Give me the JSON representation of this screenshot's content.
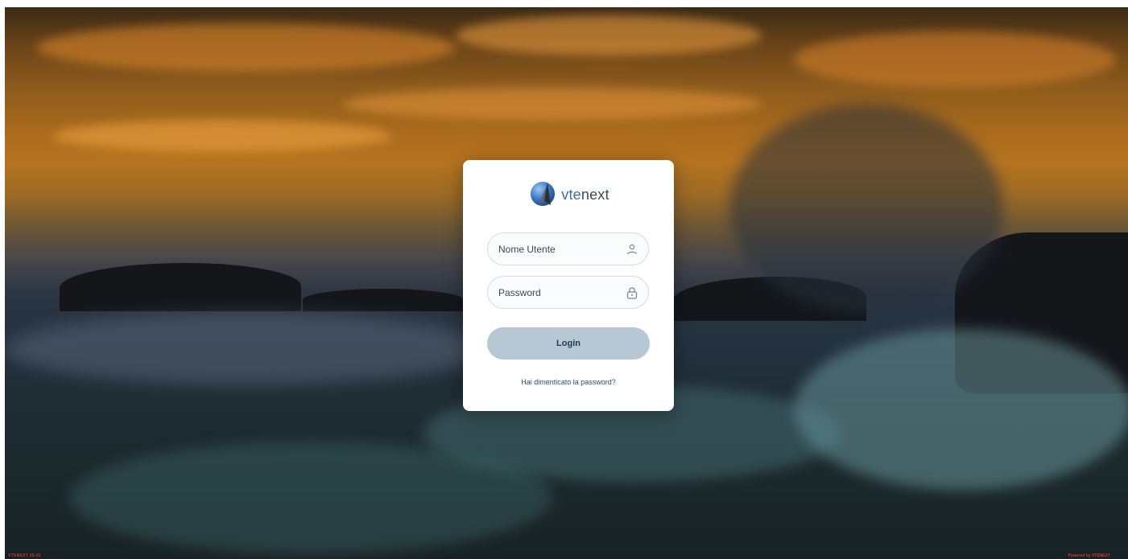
{
  "login": {
    "brand_prefix": "vte",
    "brand_suffix": "next",
    "username_placeholder": "Nome Utente",
    "password_placeholder": "Password",
    "login_label": "Login",
    "forgot_label": "Hai dimenticato la password?",
    "username_icon": "user-icon",
    "password_icon": "lock-icon"
  },
  "footer": {
    "version": "VTENEXT 25.02",
    "credits": "Powered by VTENEXT"
  },
  "colors": {
    "card_background": "#ffffff",
    "login_button": "#b6c8d3",
    "login_text": "#1f3a4c",
    "link": "#1f4d7a",
    "brand_accent": "#3b6cb2"
  }
}
